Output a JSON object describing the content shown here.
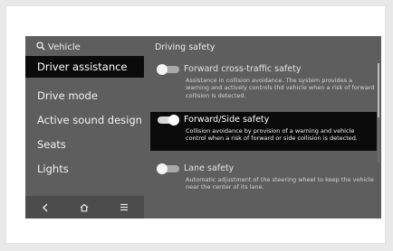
{
  "sidebar": {
    "title": "Vehicle",
    "search_icon": "search-icon",
    "items": [
      {
        "label": "Driver assistance",
        "selected": true
      },
      {
        "label": "Drive mode",
        "selected": false
      },
      {
        "label": "Active sound design",
        "selected": false
      },
      {
        "label": "Seats",
        "selected": false
      },
      {
        "label": "Lights",
        "selected": false
      }
    ],
    "bottom_nav": [
      "back-icon",
      "home-icon",
      "menu-icon"
    ]
  },
  "content": {
    "section_title": "Driving safety",
    "settings": [
      {
        "title": "Forward cross-traffic safety",
        "description": "Assistance in collision avoidance. The system provides a warning and actively controls thd vehicle when a risk of forward collision is detected.",
        "enabled": false,
        "selected": false
      },
      {
        "title": "Forward/Side safety",
        "description": "Collision avoidance by provision of a warning and vehicle control when a risk of forward or side collision is detected.",
        "enabled": true,
        "selected": true
      },
      {
        "title": "Lane safety",
        "description": "Automatic adjustment of the steering wheel to keep the vehicle near the center of its lane.",
        "enabled": false,
        "selected": false
      }
    ]
  },
  "colors": {
    "screen_bg": "#5e5e5e",
    "selected_bg": "#0b0b0b",
    "bottom_bar_bg": "#4c4c4c"
  }
}
